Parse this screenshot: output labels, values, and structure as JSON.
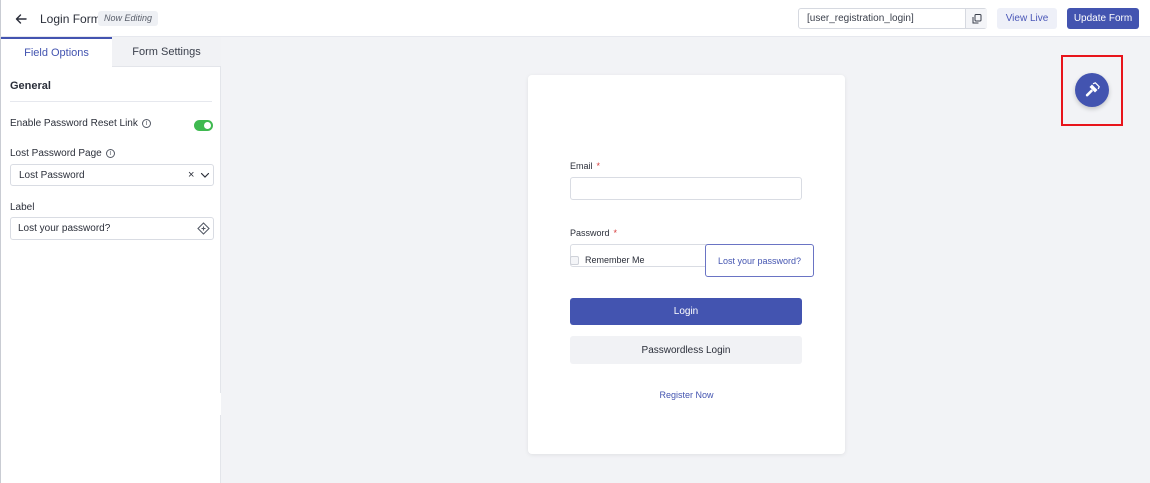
{
  "header": {
    "form_title": "Login Form",
    "editing_badge": "Now Editing",
    "shortcode": "[user_registration_login]",
    "view_live_label": "View Live",
    "update_label": "Update Form"
  },
  "sidebar": {
    "tabs": [
      {
        "label": "Field Options",
        "active": true
      },
      {
        "label": "Form Settings",
        "active": false
      }
    ],
    "section_heading": "General",
    "enable_reset_label": "Enable Password Reset Link",
    "enable_reset_on": true,
    "lost_page_label": "Lost Password Page",
    "lost_page_value": "Lost Password",
    "label_field_label": "Label",
    "label_field_value": "Lost your password?"
  },
  "form": {
    "email_label": "Email",
    "password_label": "Password",
    "required_mark": "*",
    "remember_label": "Remember Me",
    "lost_password_label": "Lost your password?",
    "login_label": "Login",
    "passwordless_label": "Passwordless Login",
    "register_label": "Register Now"
  },
  "colors": {
    "accent": "#4354b0",
    "toggle_on": "#3fb950",
    "highlight": "#e8141b"
  },
  "icons": {
    "back": "arrow-left-icon",
    "copy": "copy-icon",
    "info": "info-icon",
    "clear": "close-icon",
    "chevron": "chevron-down-icon",
    "smart_tags": "tag-icon",
    "eye": "eye-off-icon",
    "collapse": "chevron-left-icon",
    "fab": "hammer-icon"
  }
}
